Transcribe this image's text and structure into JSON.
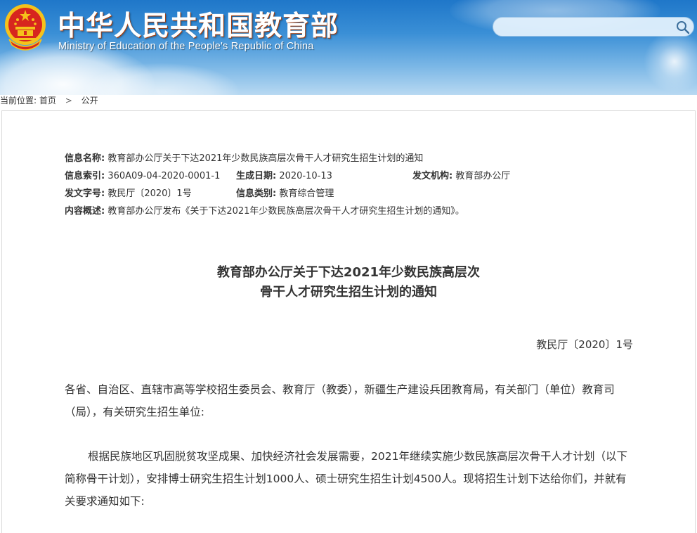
{
  "header": {
    "title": "中华人民共和国教育部",
    "subtitle": "Ministry of Education of the People's Republic of China",
    "search": {
      "placeholder": ""
    },
    "emblem_icon": "national-emblem-icon",
    "colors": {
      "banner_top": "#1f77c9",
      "banner_bottom": "#b8d9f2",
      "emblem_red": "#d7261e",
      "emblem_gold": "#f5c21b"
    }
  },
  "breadcrumb": {
    "prefix": "当前位置:",
    "items": [
      "首页",
      "公开"
    ],
    "separator": ">"
  },
  "meta": {
    "name_label": "信息名称:",
    "name_value": "教育部办公厅关于下达2021年少数民族高层次骨干人才研究生招生计划的通知",
    "index_label": "信息索引:",
    "index_value": "360A09-04-2020-0001-1",
    "date_label": "生成日期:",
    "date_value": "2020-10-13",
    "org_label": "发文机构:",
    "org_value": "教育部办公厅",
    "docno_label": "发文字号:",
    "docno_value": "教民厅〔2020〕1号",
    "category_label": "信息类别:",
    "category_value": "教育综合管理",
    "summary_label": "内容概述:",
    "summary_value": "教育部办公厅发布《关于下达2021年少数民族高层次骨干人才研究生招生计划的通知》。"
  },
  "document": {
    "title_line1": "教育部办公厅关于下达2021年少数民族高层次",
    "title_line2": "骨干人才研究生招生计划的通知",
    "number": "教民厅〔2020〕1号",
    "addressee": "各省、自治区、直辖市高等学校招生委员会、教育厅（教委），新疆生产建设兵团教育局，有关部门（单位）教育司（局），有关研究生招生单位:",
    "body": "根据民族地区巩固脱贫攻坚成果、加快经济社会发展需要，2021年继续实施少数民族高层次骨干人才计划（以下简称骨干计划），安排博士研究生招生计划1000人、硕士研究生招生计划4500人。现将招生计划下达给你们，并就有关要求通知如下:"
  }
}
